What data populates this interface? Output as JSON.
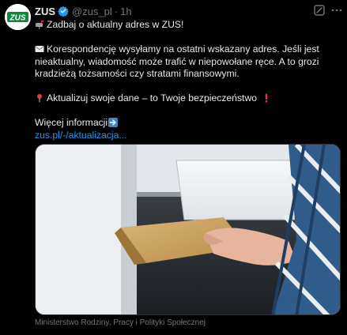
{
  "author": {
    "name": "ZUS",
    "avatar_text": "ZUS",
    "handle": "@zus_pl",
    "separator": "·",
    "time": "1h",
    "verified_color": "#1d9bf0",
    "brand_color": "#0c8a3c"
  },
  "post": {
    "line1": "Zadbaj o aktualny adres w ZUS!",
    "line1_icon": "mailbox-icon",
    "para1": "Korespondencję wysyłamy na ostatni wskazany adres. Jeśli jest nieaktualny, wiadomość może trafić w niepowołane ręce. A to grozi kradzieżą tożsamości czy stratami finansowymi.",
    "para1_icon": "envelope-icon",
    "para2": "Aktualizuj swoje dane – to Twoje bezpieczeństwo",
    "para2_icon_left": "round-pushpin-icon",
    "para2_icon_right": "exclamation-icon",
    "more_label": "Więcej informacji",
    "more_icon": "arrow-right-icon",
    "link": "zus.pl/-/aktualizacja..."
  },
  "media": {
    "alt_icon": "photo-mailbox-envelope",
    "caption": "Ministerstwo Rodziny, Pracy i Polityki Społecznej"
  },
  "icons": {
    "grok": "grok-icon",
    "more": "more-options-icon"
  },
  "colors": {
    "background": "#000000",
    "text": "#e7e9ea",
    "secondary": "#71767b",
    "link": "#1d9bf0",
    "border": "#2f3336"
  }
}
